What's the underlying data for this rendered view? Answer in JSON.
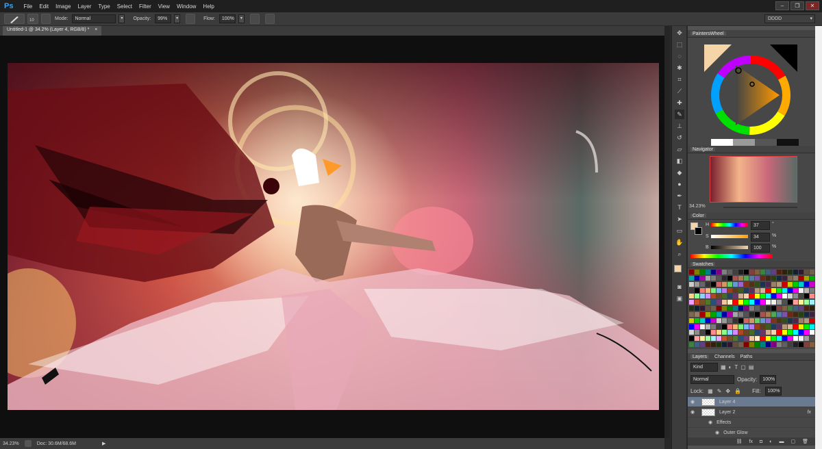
{
  "app": {
    "logo": "Ps"
  },
  "menu": [
    "File",
    "Edit",
    "Image",
    "Layer",
    "Type",
    "Select",
    "Filter",
    "View",
    "Window",
    "Help"
  ],
  "window_controls": [
    "–",
    "❐",
    "✕"
  ],
  "options": {
    "brush_size": "10",
    "mode_label": "Mode:",
    "mode_value": "Normal",
    "opacity_label": "Opacity:",
    "opacity_value": "99%",
    "flow_label": "Flow:",
    "flow_value": "100%",
    "workspace": "DDDD"
  },
  "document": {
    "tab_title": "Untitled-1 @ 34.2% (Layer 4, RGB/8) *",
    "tab_close": "×"
  },
  "status": {
    "zoom": "34.23%",
    "doc": "Doc: 30.6M/68.6M"
  },
  "panels": {
    "painters_wheel": "PaintersWheel",
    "navigator": "Navigator",
    "nav_zoom": "34.23%",
    "color": "Color",
    "color_h_label": "H",
    "color_h": "37",
    "color_h_unit": "°",
    "color_s_label": "S",
    "color_s": "34",
    "color_s_unit": "%",
    "color_b_label": "B",
    "color_b": "100",
    "color_b_unit": "%",
    "swatches": "Swatches",
    "layers_tab": "Layers",
    "channels_tab": "Channels",
    "paths_tab": "Paths",
    "kind": "Kind",
    "blend": "Normal",
    "opacity_label": "Opacity:",
    "opacity": "100%",
    "lock_label": "Lock:",
    "fill_label": "Fill:",
    "fill": "100%",
    "layers": [
      {
        "name": "Layer 4"
      },
      {
        "name": "Layer 2",
        "fx": "fx"
      }
    ],
    "effects": "Effects",
    "outer_glow": "Outer Glow",
    "footer_fx": "fx"
  },
  "colors": {
    "accent": "#31a8ff",
    "foreground": "#f5d5a8",
    "background": "#000000"
  }
}
